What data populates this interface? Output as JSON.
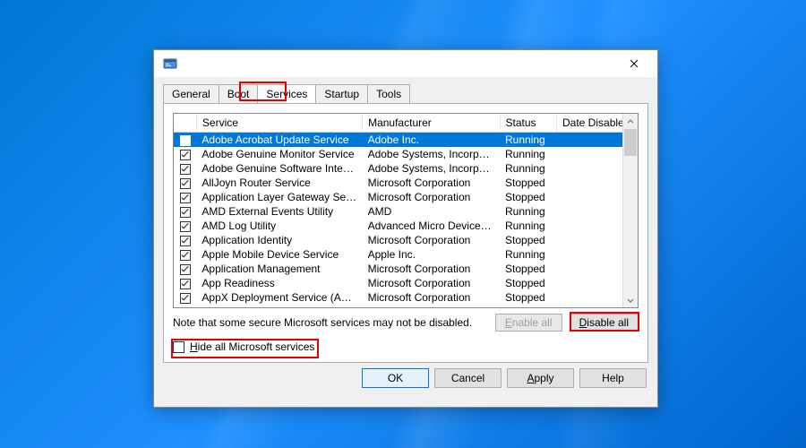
{
  "tabs": {
    "general": "General",
    "boot": "Boot",
    "services": "Services",
    "startup": "Startup",
    "tools": "Tools",
    "active": "services"
  },
  "columns": {
    "service": "Service",
    "manufacturer": "Manufacturer",
    "status": "Status",
    "dateDisabled": "Date Disabled"
  },
  "rows": [
    {
      "svc": "Adobe Acrobat Update Service",
      "mfr": "Adobe Inc.",
      "status": "Running",
      "checked": true,
      "selected": true
    },
    {
      "svc": "Adobe Genuine Monitor Service",
      "mfr": "Adobe Systems, Incorpora...",
      "status": "Running",
      "checked": true
    },
    {
      "svc": "Adobe Genuine Software Integri...",
      "mfr": "Adobe Systems, Incorpora...",
      "status": "Running",
      "checked": true
    },
    {
      "svc": "AllJoyn Router Service",
      "mfr": "Microsoft Corporation",
      "status": "Stopped",
      "checked": true
    },
    {
      "svc": "Application Layer Gateway Service",
      "mfr": "Microsoft Corporation",
      "status": "Stopped",
      "checked": true
    },
    {
      "svc": "AMD External Events Utility",
      "mfr": "AMD",
      "status": "Running",
      "checked": true
    },
    {
      "svc": "AMD Log Utility",
      "mfr": "Advanced Micro Devices, I...",
      "status": "Running",
      "checked": true
    },
    {
      "svc": "Application Identity",
      "mfr": "Microsoft Corporation",
      "status": "Stopped",
      "checked": true
    },
    {
      "svc": "Apple Mobile Device Service",
      "mfr": "Apple Inc.",
      "status": "Running",
      "checked": true
    },
    {
      "svc": "Application Management",
      "mfr": "Microsoft Corporation",
      "status": "Stopped",
      "checked": true
    },
    {
      "svc": "App Readiness",
      "mfr": "Microsoft Corporation",
      "status": "Stopped",
      "checked": true
    },
    {
      "svc": "AppX Deployment Service (AppX...",
      "mfr": "Microsoft Corporation",
      "status": "Stopped",
      "checked": true
    }
  ],
  "note": "Note that some secure Microsoft services may not be disabled.",
  "buttons": {
    "enableAll": "Enable all",
    "disableAll": "Disable all",
    "hideMs": "Hide all Microsoft services",
    "ok": "OK",
    "cancel": "Cancel",
    "apply": "Apply",
    "help": "Help"
  }
}
